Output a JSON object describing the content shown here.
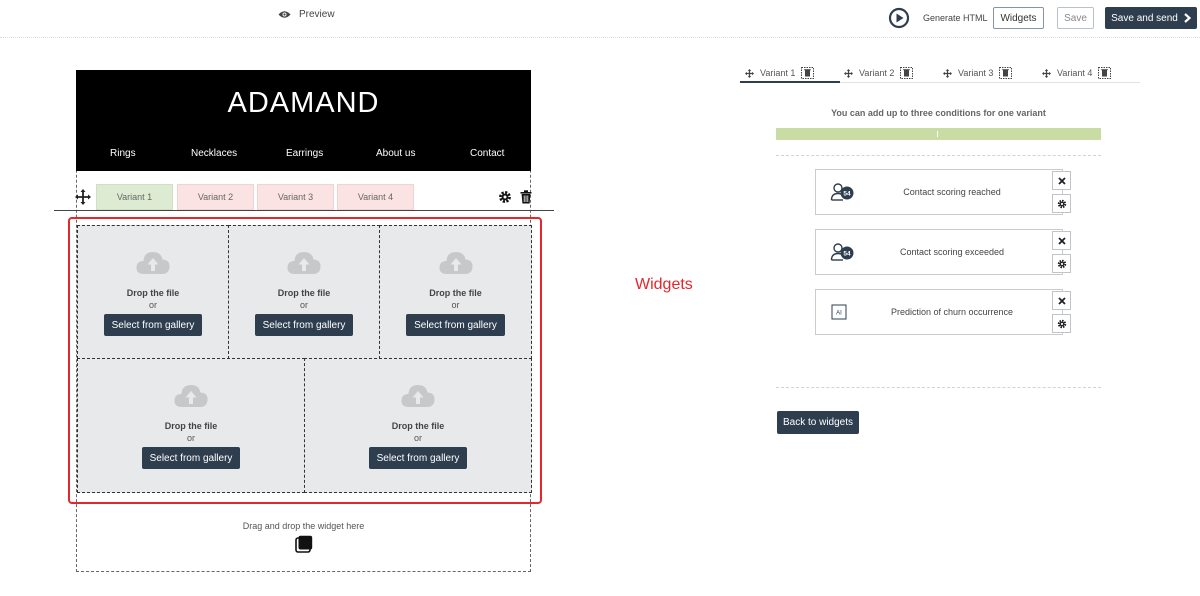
{
  "topbar": {
    "preview_label": "Preview",
    "generate_html_label": "Generate HTML",
    "widgets_label": "Widgets",
    "save_label": "Save",
    "save_send_label": "Save and send"
  },
  "banner": {
    "title": "ADAMAND",
    "nav": [
      "Rings",
      "Necklaces",
      "Earrings",
      "About us",
      "Contact"
    ]
  },
  "variant_tabs": [
    {
      "label": "Variant   1"
    },
    {
      "label": "Variant   2"
    },
    {
      "label": "Variant   3"
    },
    {
      "label": "Variant   4"
    }
  ],
  "upload_cell": {
    "drop_label": "Drop the file",
    "or_label": "or",
    "gallery_label": "Select from gallery"
  },
  "drag_drop_label": "Drag and drop the widget here",
  "annotation": "Widgets",
  "right_panel": {
    "tabs": [
      {
        "label": "Variant   1"
      },
      {
        "label": "Variant   2"
      },
      {
        "label": "Variant   3"
      },
      {
        "label": "Variant   4"
      }
    ],
    "conditions_hint": "You can add up to three conditions for one variant",
    "cards": [
      {
        "label": "Contact scoring reached",
        "badge": "54",
        "icon": "user-score-icon"
      },
      {
        "label": "Contact scoring exceeded",
        "badge": "54",
        "icon": "user-score-icon"
      },
      {
        "label": "Prediction of churn occurrence",
        "badge": "AI",
        "icon": "ai-icon"
      }
    ],
    "back_label": "Back to widgets"
  },
  "colors": {
    "dark": "#2e3e4f",
    "red_annotation": "#e2272d",
    "variant_active": "#dcebd2",
    "variant_inactive": "#fbe3e3",
    "progress_green": "#c8dca4"
  }
}
